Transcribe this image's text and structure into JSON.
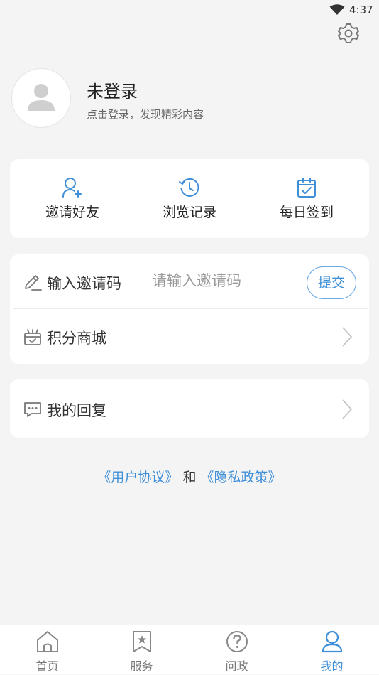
{
  "status_bar": {
    "time": "4:37"
  },
  "profile": {
    "name": "未登录",
    "subtitle": "点击登录，发现精彩内容"
  },
  "quick_actions": [
    {
      "label": "邀请好友",
      "icon": "add-user-icon"
    },
    {
      "label": "浏览记录",
      "icon": "history-icon"
    },
    {
      "label": "每日签到",
      "icon": "calendar-check-icon"
    }
  ],
  "invite": {
    "label": "输入邀请码",
    "placeholder": "请输入邀请码",
    "value": "",
    "submit_label": "提交"
  },
  "mall": {
    "label": "积分商城"
  },
  "replies": {
    "label": "我的回复"
  },
  "footer_links": {
    "agreement": "《用户协议》",
    "and": "和",
    "privacy": "《隐私政策》"
  },
  "tabs": [
    {
      "label": "首页",
      "icon": "home-icon",
      "active": false
    },
    {
      "label": "服务",
      "icon": "bookmark-star-icon",
      "active": false
    },
    {
      "label": "问政",
      "icon": "question-icon",
      "active": false
    },
    {
      "label": "我的",
      "icon": "user-icon",
      "active": true
    }
  ],
  "colors": {
    "accent": "#3f8fd8",
    "background": "#f4f4f4",
    "card": "#ffffff"
  }
}
